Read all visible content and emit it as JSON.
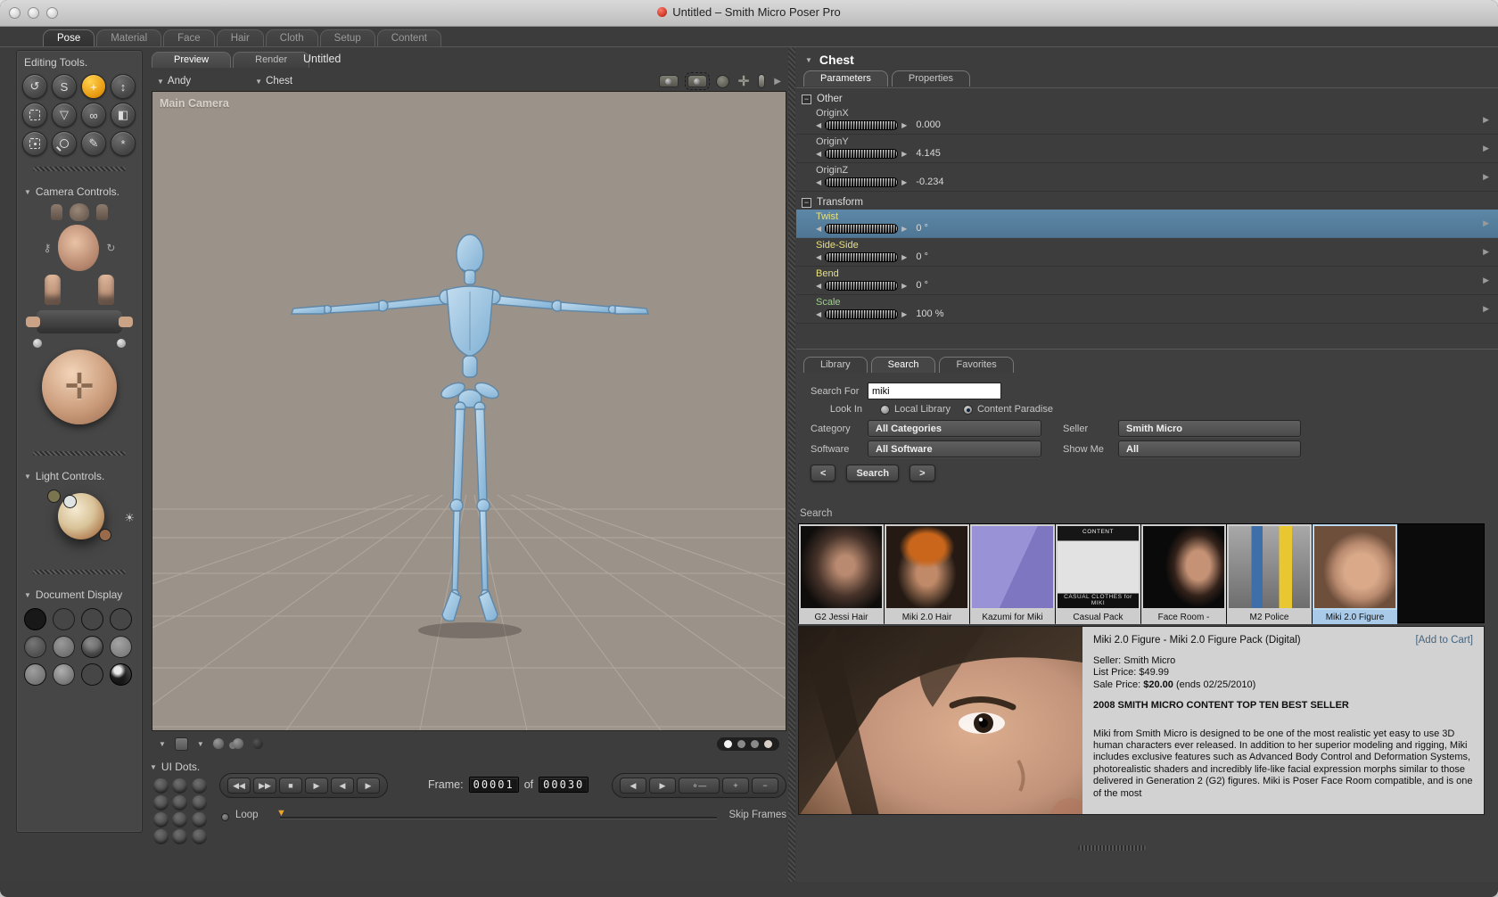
{
  "window": {
    "title": "Untitled – Smith Micro Poser Pro"
  },
  "tabs": {
    "active": "Pose",
    "items": [
      "Pose",
      "Material",
      "Face",
      "Hair",
      "Cloth",
      "Setup",
      "Content"
    ]
  },
  "sidebar": {
    "editing_tools": {
      "title": "Editing Tools.",
      "tools": [
        {
          "name": "rotate",
          "glyph": "↺"
        },
        {
          "name": "twist",
          "glyph": "S"
        },
        {
          "name": "translate-pull",
          "glyph": "+",
          "active": true
        },
        {
          "name": "translate-in-out",
          "glyph": "↕"
        },
        {
          "name": "scale",
          "css": "dashed"
        },
        {
          "name": "taper",
          "glyph": "▽"
        },
        {
          "name": "chain-break",
          "glyph": "∞"
        },
        {
          "name": "color",
          "glyph": "◧"
        },
        {
          "name": "grouping",
          "css": "dashed-dot"
        },
        {
          "name": "view-magnifier",
          "css": "lens"
        },
        {
          "name": "morphing",
          "glyph": "✎"
        },
        {
          "name": "direct-manipulation",
          "glyph": "*"
        }
      ]
    },
    "camera_controls": {
      "title": "Camera Controls."
    },
    "light_controls": {
      "title": "Light Controls."
    },
    "document_display": {
      "title": "Document Display",
      "styles": [
        "silhouette",
        "outline",
        "wireframe",
        "hidden-line",
        "lit-wireframe",
        "flat-shaded",
        "flat-lined",
        "cartoon",
        "cartoon-with-line",
        "smooth-shaded",
        "smooth-lined",
        "texture-shaded"
      ]
    },
    "ui_dots": {
      "title": "UI Dots."
    }
  },
  "viewport": {
    "doc_tabs": [
      "Preview",
      "Render"
    ],
    "active_doc_tab": "Preview",
    "doc_title": "Untitled",
    "actor_menu": "Andy",
    "part_menu": "Chest",
    "camera_label": "Main Camera"
  },
  "params": {
    "header": "Chest",
    "tabs": [
      "Parameters",
      "Properties"
    ],
    "active_tab": "Parameters",
    "groups": [
      {
        "name": "Other",
        "rows": [
          {
            "label": "OriginX",
            "value": "0.000",
            "color": "gray"
          },
          {
            "label": "OriginY",
            "value": "4.145",
            "color": "gray"
          },
          {
            "label": "OriginZ",
            "value": "-0.234",
            "color": "gray"
          }
        ]
      },
      {
        "name": "Transform",
        "rows": [
          {
            "label": "Twist",
            "value": "0 °",
            "color": "yellow",
            "highlighted": true
          },
          {
            "label": "Side-Side",
            "value": "0 °",
            "color": "yellow"
          },
          {
            "label": "Bend",
            "value": "0 °",
            "color": "yellow"
          },
          {
            "label": "Scale",
            "value": "100 %",
            "color": "green"
          }
        ]
      }
    ]
  },
  "library": {
    "tabs": [
      "Library",
      "Search",
      "Favorites"
    ],
    "active_tab": "Search",
    "form": {
      "search_for_label": "Search For",
      "search_value": "miki",
      "look_in_label": "Look In",
      "radios": [
        {
          "label": "Local Library",
          "selected": false
        },
        {
          "label": "Content Paradise",
          "selected": true
        }
      ],
      "category_label": "Category",
      "category_value": "All Categories",
      "seller_label": "Seller",
      "seller_value": "Smith Micro",
      "software_label": "Software",
      "software_value": "All Software",
      "show_me_label": "Show Me",
      "show_me_value": "All",
      "prev_label": "<",
      "search_label": "Search",
      "next_label": ">"
    },
    "section_label": "Search",
    "results": [
      {
        "name": "G2 Jessi Hair",
        "cls": "t-jessi"
      },
      {
        "name": "Miki 2.0 Hair",
        "cls": "t-mikihair"
      },
      {
        "name": "Kazumi for Miki",
        "cls": "t-kazumi",
        "cap_top": "",
        "cap_bottom": ""
      },
      {
        "name": "Casual Pack",
        "cls": "t-casual",
        "cap_top": "CONTENT",
        "cap_bottom": "CASUAL CLOTHES for MIKI"
      },
      {
        "name": "Face Room -",
        "cls": "t-facer"
      },
      {
        "name": "M2 Police",
        "cls": "t-police"
      },
      {
        "name": "Miki 2.0 Figure",
        "cls": "t-miki",
        "selected": true
      }
    ]
  },
  "product": {
    "title": "Miki 2.0 Figure - Miki 2.0 Figure Pack (Digital)",
    "add_to_cart": "[Add to Cart]",
    "seller": "Seller: Smith Micro",
    "list_price": "List Price: $49.99",
    "sale_price_label": "Sale Price:",
    "sale_price_value": "$20.00",
    "sale_price_ends": "(ends 02/25/2010)",
    "banner": "2008 SMITH MICRO CONTENT TOP TEN BEST SELLER",
    "description": "Miki from Smith Micro is designed to be one of the most realistic yet easy to use 3D human characters ever released. In addition to her superior modeling and rigging, Miki includes exclusive features such as Advanced Body Control and Deformation Systems, photorealistic shaders and incredibly life-like facial expression morphs similar to those delivered in Generation 2 (G2) figures. Miki is Poser Face Room compatible, and is one of the most"
  },
  "animation": {
    "frame_label": "Frame:",
    "frame_current": "00001",
    "of_label": "of",
    "frame_total": "00030",
    "loop_label": "Loop",
    "skip_frames_label": "Skip Frames",
    "transport": [
      {
        "name": "first-frame",
        "glyph": "◀◀"
      },
      {
        "name": "last-frame",
        "glyph": "▶▶"
      },
      {
        "name": "stop",
        "glyph": "■"
      },
      {
        "name": "play",
        "glyph": "▶"
      },
      {
        "name": "step-back",
        "glyph": "◀"
      },
      {
        "name": "step-forward",
        "glyph": "▶"
      }
    ],
    "key_controls": [
      {
        "name": "previous-key",
        "glyph": "◀"
      },
      {
        "name": "next-key",
        "glyph": "▶"
      },
      {
        "name": "edit-keyframes",
        "glyph": "⚬―"
      },
      {
        "name": "add-keyframe",
        "glyph": "+"
      },
      {
        "name": "delete-keyframe",
        "glyph": "−"
      }
    ]
  },
  "colors": {
    "accent_orange": "#e89b12",
    "highlight_row": "#557fa0",
    "label_yellow": "#e6e07a",
    "label_green": "#9ed08c",
    "selected_thumb": "#a9cbe9",
    "viewport_bg": "#9b9289",
    "figure_blue": "#a6cbe7"
  }
}
